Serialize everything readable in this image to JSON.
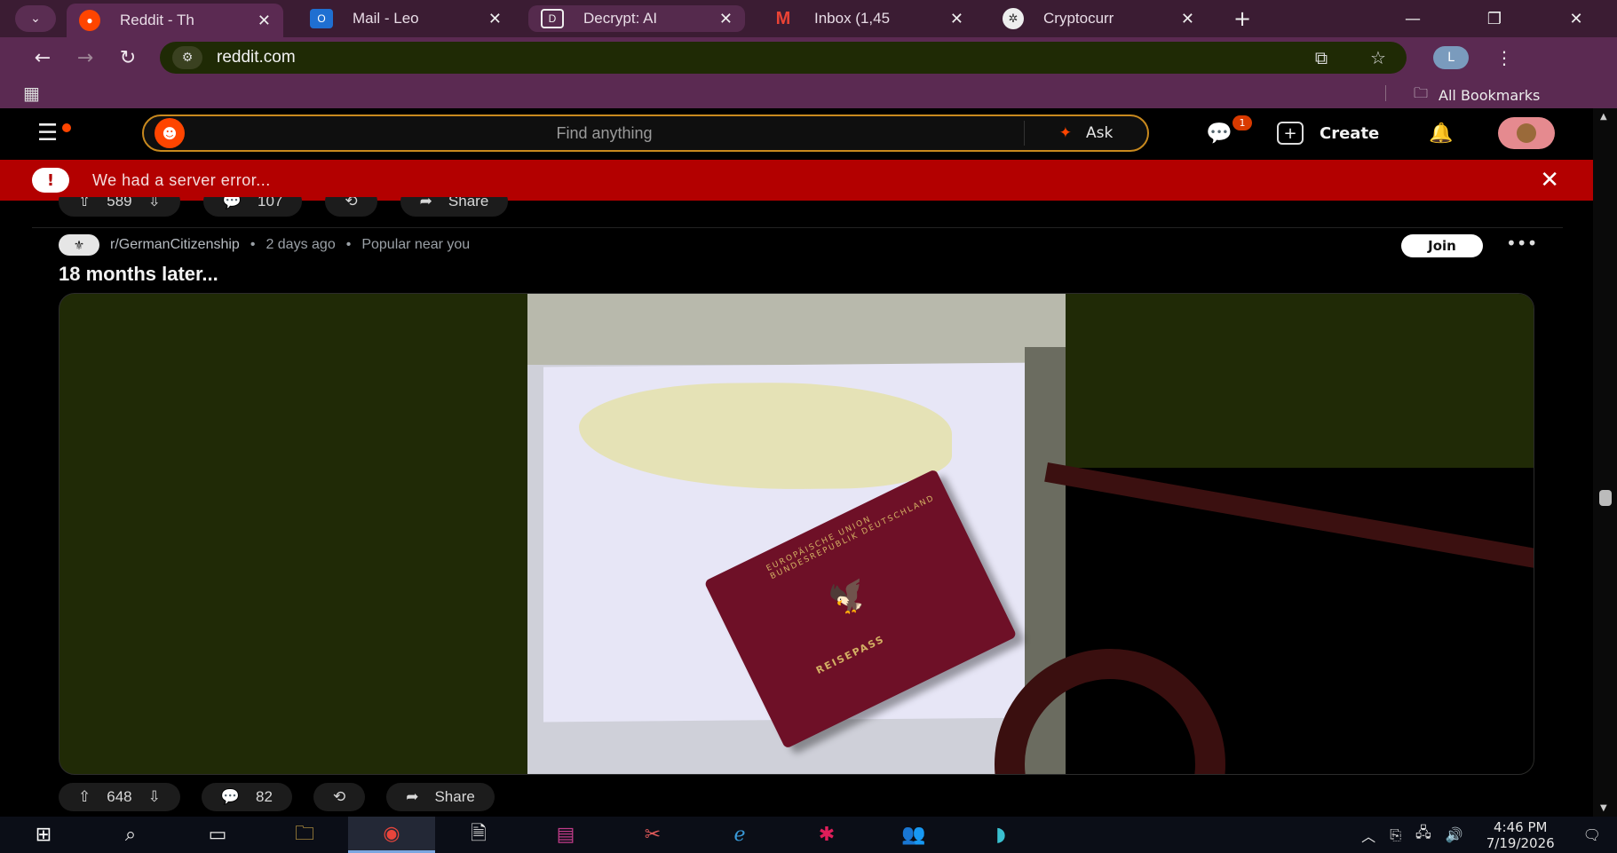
{
  "browser": {
    "tabs": [
      {
        "title": "Reddit - Th",
        "favicon": "reddit-icon",
        "active": true
      },
      {
        "title": "Mail - Leo",
        "favicon": "outlook-icon",
        "active": false
      },
      {
        "title": "Decrypt: AI",
        "favicon": "decrypt-icon",
        "active": false
      },
      {
        "title": "Inbox (1,45",
        "favicon": "gmail-icon",
        "active": false
      },
      {
        "title": "Cryptocurr",
        "favicon": "openai-icon",
        "active": false
      }
    ],
    "url": "reddit.com",
    "profile_initial": "L",
    "bookmarks_label": "All Bookmarks"
  },
  "reddit": {
    "search_placeholder": "Find anything",
    "ask_label": "Ask",
    "chat_badge": "1",
    "create_label": "Create",
    "error_message": "We had a server error...",
    "prev_post": {
      "votes": "589",
      "comments": "107",
      "share_label": "Share"
    },
    "post": {
      "subreddit": "r/GermanCitizenship",
      "age": "2 days ago",
      "tag": "Popular near you",
      "join_label": "Join",
      "title": "18 months later...",
      "passport_top": "EUROPÄISCHE UNION BUNDESREPUBLIK DEUTSCHLAND",
      "passport_label": "REISEPASS",
      "votes": "648",
      "comments": "82",
      "share_label": "Share"
    }
  },
  "taskbar": {
    "time": "4:46 PM",
    "date": "7/19/2026"
  },
  "colors": {
    "tabstrip": "#3b1c33",
    "toolbar": "#5b2a52",
    "reddit_orange": "#ff4500",
    "error_red": "#b30000"
  }
}
